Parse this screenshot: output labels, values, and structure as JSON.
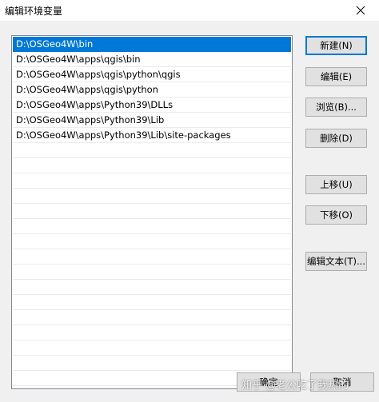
{
  "window": {
    "title": "编辑环境变量"
  },
  "paths": [
    "D:\\OSGeo4W\\bin",
    "D:\\OSGeo4W\\apps\\qgis\\bin",
    "D:\\OSGeo4W\\apps\\qgis\\python\\qgis",
    "D:\\OSGeo4W\\apps\\qgis\\python",
    "D:\\OSGeo4W\\apps\\Python39\\DLLs",
    "D:\\OSGeo4W\\apps\\Python39\\Lib",
    "D:\\OSGeo4W\\apps\\Python39\\Lib\\site-packages"
  ],
  "selected_index": 0,
  "buttons": {
    "new": "新建(N)",
    "edit": "编辑(E)",
    "browse": "浏览(B)...",
    "delete": "删除(D)",
    "move_up": "上移(U)",
    "move_down": "下移(O)",
    "edit_text": "编辑文本(T)...",
    "ok": "确定",
    "cancel": "取消"
  },
  "watermark": "知乎 @老公吃了我热的",
  "colors": {
    "selection": "#0078d7",
    "button_face": "#e1e1e1"
  }
}
